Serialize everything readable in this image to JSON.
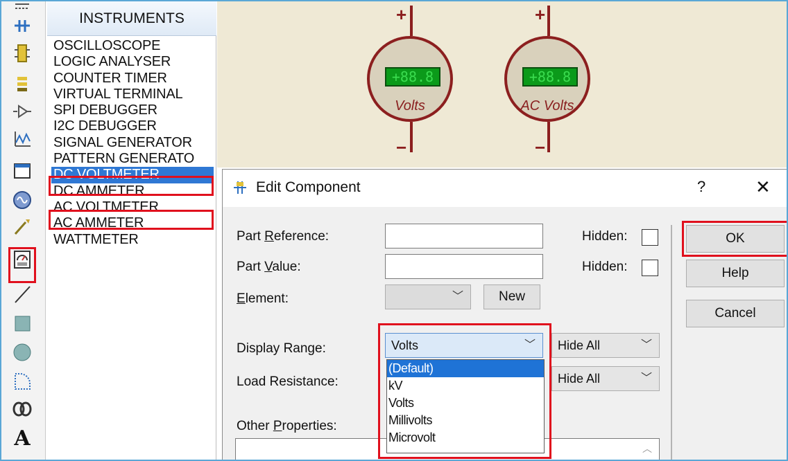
{
  "instruments_panel": {
    "header": "INSTRUMENTS",
    "items": [
      {
        "label": "OSCILLOSCOPE"
      },
      {
        "label": "LOGIC ANALYSER"
      },
      {
        "label": "COUNTER TIMER"
      },
      {
        "label": "VIRTUAL TERMINAL"
      },
      {
        "label": "SPI DEBUGGER"
      },
      {
        "label": "I2C DEBUGGER"
      },
      {
        "label": "SIGNAL GENERATOR"
      },
      {
        "label": "PATTERN GENERATO"
      },
      {
        "label": "DC VOLTMETER"
      },
      {
        "label": "DC AMMETER"
      },
      {
        "label": "AC VOLTMETER"
      },
      {
        "label": "AC AMMETER"
      },
      {
        "label": "WATTMETER"
      }
    ],
    "selected_item": "DC VOLTMETER"
  },
  "toolbar": {
    "tools": [
      "bus-icon",
      "junction-icon",
      "component-icon",
      "terminal-icon",
      "port-icon",
      "graph-icon",
      "tape-icon",
      "generator-icon",
      "probe-icon",
      "instrument-icon",
      "line-icon",
      "box-icon",
      "circle-icon",
      "arc-icon",
      "path-icon",
      "text-icon"
    ],
    "text_tool_glyph": "A"
  },
  "canvas": {
    "meters": [
      {
        "display": "+88.8",
        "label": "Volts",
        "plus": "+",
        "minus": "−"
      },
      {
        "display": "+88.8",
        "label": "AC Volts",
        "plus": "+",
        "minus": "−"
      }
    ]
  },
  "dialog": {
    "title": "Edit Component",
    "help_glyph": "?",
    "close_glyph": "✕",
    "fields": {
      "part_reference": {
        "label_pre": "Part ",
        "label_u": "R",
        "label_post": "eference:",
        "value": ""
      },
      "part_value": {
        "label_pre": "Part ",
        "label_u": "V",
        "label_post": "alue:",
        "value": ""
      },
      "element": {
        "label_pre": "",
        "label_u": "E",
        "label_post": "lement:",
        "value": ""
      },
      "display_range": {
        "label": "Display Range:",
        "value": "Volts"
      },
      "load_resistance": {
        "label": "Load Resistance:"
      },
      "other_properties": {
        "label_pre": "Other ",
        "label_u": "P",
        "label_post": "roperties:"
      }
    },
    "hidden_label": "Hidden:",
    "hide_all_label": "Hide All",
    "new_button": "New",
    "buttons": {
      "ok": "OK",
      "help": "Help",
      "cancel": "Cancel"
    },
    "display_range_options": [
      "(Default)",
      "kV",
      "Volts",
      "Millivolts",
      "Microvolt"
    ],
    "display_range_highlighted": "(Default)",
    "accent_color": "#1f73d6",
    "highlight_box_color": "#e0101d"
  }
}
